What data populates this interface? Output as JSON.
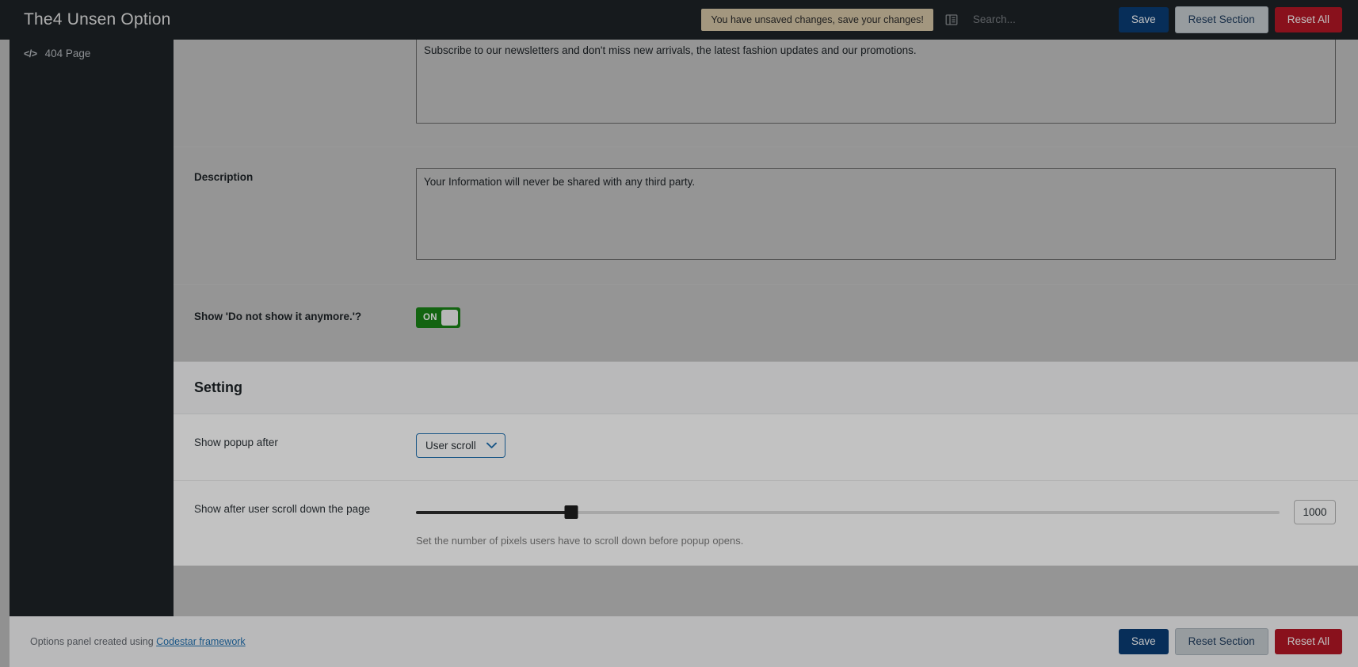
{
  "header": {
    "brand": "The4 Unsen Option",
    "unsaved_notice": "You have unsaved changes, save your changes!",
    "collapse_icon": "collapse-sidebar-icon",
    "search_placeholder": "Search...",
    "search_value": "",
    "save_label": "Save",
    "reset_section_label": "Reset Section",
    "reset_all_label": "Reset All",
    "colors": {
      "bar": "#1d2327",
      "notice_bg": "#d6c7a8",
      "save": "#0a3d76",
      "reset_section": "#c7cdd2",
      "reset_all": "#b51726"
    }
  },
  "sidebar": {
    "items": [
      {
        "icon": "code-icon",
        "glyph": "</>",
        "label": "404 Page"
      }
    ]
  },
  "main": {
    "fields": [
      {
        "name": "subtitle-field",
        "label": "",
        "type": "textarea",
        "value": "Subscribe to our newsletters and don't miss new arrivals, the latest fashion updates and our promotions."
      },
      {
        "name": "description-field",
        "label": "Description",
        "type": "textarea",
        "value": "Your Information will never be shared with any third party."
      },
      {
        "name": "show-do-not-show-again-field",
        "label": "Show 'Do not show it anymore.'?",
        "type": "toggle",
        "state_label": "ON",
        "on": true
      }
    ],
    "section": {
      "title": "Setting",
      "fields": [
        {
          "name": "show-popup-after-field",
          "label": "Show popup after",
          "type": "select",
          "value": "User scroll",
          "options": [
            "User scroll"
          ]
        },
        {
          "name": "scroll-depth-field",
          "label": "Show after user scroll down the page",
          "type": "slider",
          "value": "1000",
          "percent": 18,
          "help": "Set the number of pixels users have to scroll down before popup opens."
        }
      ]
    }
  },
  "footer": {
    "credit_prefix": "Options panel created using ",
    "credit_link": "Codestar framework",
    "save_label": "Save",
    "reset_section_label": "Reset Section",
    "reset_all_label": "Reset All"
  }
}
